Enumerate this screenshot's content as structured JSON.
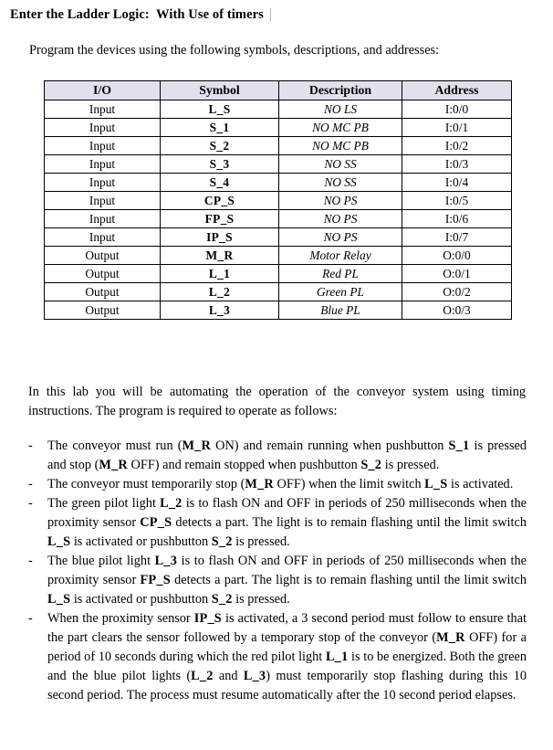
{
  "document": {
    "title": "Enter the Ladder Logic:  With Use of timers",
    "intro": "Program the devices using the following symbols, descriptions, and addresses:",
    "lab_paragraph": "In this lab you will be automating the operation of the conveyor system using timing instructions. The program is required to operate as follows:",
    "bullet_marker": "-"
  },
  "table": {
    "headers": [
      "I/O",
      "Symbol",
      "Description",
      "Address"
    ],
    "rows": [
      {
        "io": "Input",
        "symbol": "L_S",
        "description": "NO LS",
        "address": "I:0/0"
      },
      {
        "io": "Input",
        "symbol": "S_1",
        "description": "NO MC PB",
        "address": "I:0/1"
      },
      {
        "io": "Input",
        "symbol": "S_2",
        "description": "NO MC PB",
        "address": "I:0/2"
      },
      {
        "io": "Input",
        "symbol": "S_3",
        "description": "NO SS",
        "address": "I:0/3"
      },
      {
        "io": "Input",
        "symbol": "S_4",
        "description": "NO SS",
        "address": "I:0/4"
      },
      {
        "io": "Input",
        "symbol": "CP_S",
        "description": "NO PS",
        "address": "I:0/5"
      },
      {
        "io": "Input",
        "symbol": "FP_S",
        "description": "NO PS",
        "address": "I:0/6"
      },
      {
        "io": "Input",
        "symbol": "IP_S",
        "description": "NO PS",
        "address": "I:0/7"
      },
      {
        "io": "Output",
        "symbol": "M_R",
        "description": "Motor Relay",
        "address": "O:0/0"
      },
      {
        "io": "Output",
        "symbol": "L_1",
        "description": "Red PL",
        "address": "O:0/1"
      },
      {
        "io": "Output",
        "symbol": "L_2",
        "description": "Green PL",
        "address": "O:0/2"
      },
      {
        "io": "Output",
        "symbol": "L_3",
        "description": "Blue PL",
        "address": "O:0/3"
      }
    ]
  },
  "requirements": [
    {
      "id": "conveyor-run-stop",
      "html": "The conveyor must run (<b>M_R</b> ON) and remain running when pushbutton <b>S_1</b> is pressed and stop (<b>M_R</b> OFF) and remain stopped when pushbutton <b>S_2</b> is pressed."
    },
    {
      "id": "conveyor-temp-stop",
      "html": "The conveyor must temporarily stop (<b>M_R</b> OFF) when the limit switch <b>L_S</b> is activated."
    },
    {
      "id": "green-pilot-light",
      "html": "The green pilot light <b>L_2</b> is to flash ON and OFF in periods of 250 milliseconds when the proximity sensor <b>CP_S</b> detects a part. The light is to remain flashing until the limit switch <b>L_S</b> is activated or pushbutton <b>S_2</b> is pressed."
    },
    {
      "id": "blue-pilot-light",
      "html": "The blue pilot light <b>L_3</b> is to flash ON and OFF in periods of 250 milliseconds when the proximity sensor <b>FP_S</b> detects a part. The light is to remain flashing until the limit switch <b>L_S</b> is activated or pushbutton <b>S_2</b> is pressed."
    },
    {
      "id": "ip-sensor-sequence",
      "html": "When the proximity sensor <b>IP_S</b> is activated, a 3 second period must follow to ensure that the part clears the sensor followed by a temporary stop of the conveyor (<b>M_R</b> OFF) for a period of 10 seconds during which the red pilot light <b>L_1</b> is to be energized. Both the green and the blue pilot lights (<b>L_2</b> and <b>L_3</b>) must temporarily stop flashing during this 10 second period. The process must resume automatically after the 10 second period elapses."
    }
  ],
  "colors": {
    "table_header_fill": "#e4dfec",
    "table_border": "#000000",
    "page_background": "#ffffff",
    "text": "#000000",
    "caret": "#b9b9b9"
  }
}
